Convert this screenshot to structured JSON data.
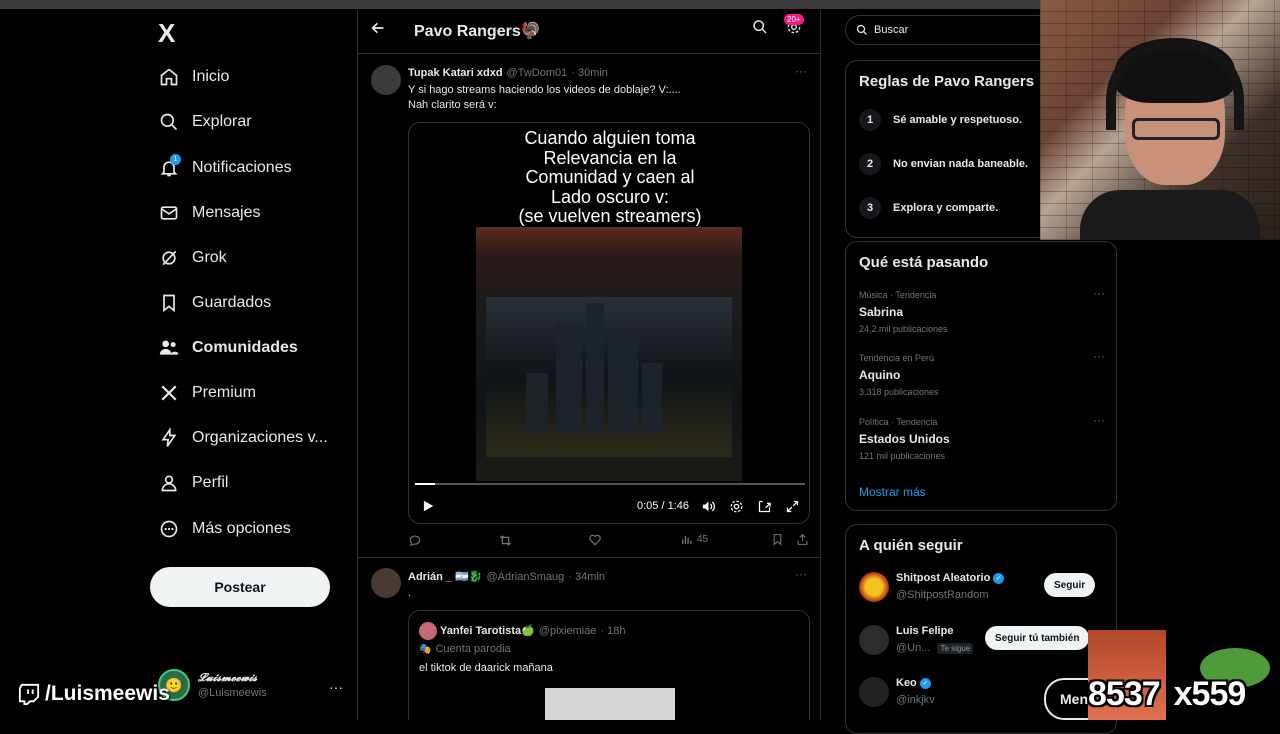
{
  "sidebar": {
    "logo": "X",
    "nav": [
      {
        "label": "Inicio",
        "icon": "home-icon"
      },
      {
        "label": "Explorar",
        "icon": "search-icon"
      },
      {
        "label": "Notificaciones",
        "icon": "bell-icon",
        "badge": "1"
      },
      {
        "label": "Mensajes",
        "icon": "mail-icon"
      },
      {
        "label": "Grok",
        "icon": "grok-icon"
      },
      {
        "label": "Guardados",
        "icon": "bookmark-icon"
      },
      {
        "label": "Comunidades",
        "icon": "communities-icon"
      },
      {
        "label": "Premium",
        "icon": "x-logo-icon"
      },
      {
        "label": "Organizaciones v...",
        "icon": "lightning-icon"
      },
      {
        "label": "Perfil",
        "icon": "person-icon"
      },
      {
        "label": "Más opciones",
        "icon": "more-circle-icon"
      }
    ],
    "post_button": "Postear",
    "account": {
      "name": "𝓛𝓾𝓲𝓼𝓶𝓮𝓮𝔀𝓲𝓼",
      "handle": "@Luismeewis",
      "more": "···"
    }
  },
  "twitch": {
    "label": "/Luismeewis"
  },
  "header": {
    "title": "Pavo Rangers🦃",
    "badge": "20+"
  },
  "tweets": [
    {
      "name": "Tupak Katari xdxd",
      "handle": "@TwDom01",
      "time": "· 30min",
      "text_line1": "Y si hago streams haciendo los videos de doblaje? V:....",
      "text_line2": "Nah clarito será v:",
      "caption": [
        "Cuando alguien toma",
        "Relevancia en la",
        "Comunidad y caen al",
        "Lado oscuro v:",
        "(se vuelven streamers)"
      ],
      "video_time": "0:05 / 1:46",
      "video_progress": 0.05,
      "views": "45"
    },
    {
      "name": "Adrián _ 🇦🇷🐉",
      "handle": "@AdrianSmaug",
      "time": "· 34min",
      "text": ".",
      "quote": {
        "name": "Yanfei Tarotista🍏",
        "handle": "@pixiemiae",
        "time": "· 18h",
        "label": "Cuenta parodia",
        "text": "el tiktok de daarick mañana"
      }
    }
  ],
  "right": {
    "search_placeholder": "Buscar",
    "rules_title": "Reglas de Pavo Rangers",
    "rules": [
      {
        "num": "1",
        "text": "Sé amable y respetuoso."
      },
      {
        "num": "2",
        "text": "No envian nada baneable."
      },
      {
        "num": "3",
        "text": "Explora y comparte."
      }
    ],
    "trends_title": "Qué está pasando",
    "trends": [
      {
        "category": "Música · Tendencia",
        "name": "Sabrina",
        "count": "24,2 mil publicaciones"
      },
      {
        "category": "Tendencia en Perú",
        "name": "Aquino",
        "count": "3.318 publicaciones"
      },
      {
        "category": "Política · Tendencia",
        "name": "Estados Unidos",
        "count": "121 mil publicaciones"
      }
    ],
    "show_more": "Mostrar más",
    "follow_title": "A quién seguir",
    "follow": [
      {
        "name": "Shitpost Aleatorio",
        "handle": "@ShitpostRandom",
        "button": "Seguir",
        "verified": true
      },
      {
        "name": "Luis Felipe",
        "handle": "@Un...",
        "button": "Seguir tú también",
        "tag": "Te sigue"
      },
      {
        "name": "Keo",
        "handle": "@inkjkv",
        "verified": true
      }
    ]
  },
  "overlay": {
    "button": "Men",
    "counter_a": "8537",
    "counter_b": "x559"
  }
}
